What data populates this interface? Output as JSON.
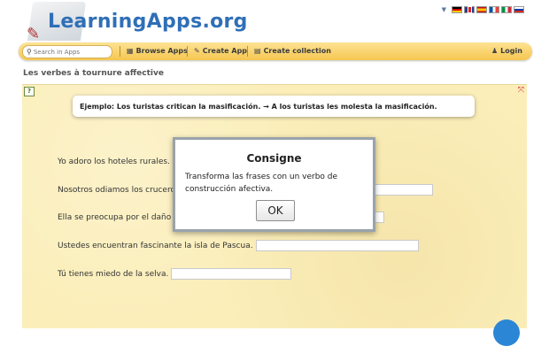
{
  "header": {
    "logo_text": "LearningApps.org",
    "flags": [
      "de",
      "gb",
      "es",
      "fr",
      "it",
      "ru"
    ]
  },
  "navbar": {
    "search_placeholder": "Search in Apps",
    "browse_label": "Browse Apps",
    "create_app_label": "Create App",
    "create_collection_label": "Create collection",
    "login_label": "Login"
  },
  "page": {
    "title": "Les verbes à tournure affective"
  },
  "app": {
    "example": "Ejemplo: Los turistas critican la masificación. → A los turistas les molesta la masificación.",
    "rows": [
      {
        "text": "Yo adoro los hoteles rurales."
      },
      {
        "text": "Nosotros odiamos los cruceros."
      },
      {
        "text": "Ella se preocupa por el daño"
      },
      {
        "text": "Ustedes encuentran fascinante la isla de Pascua."
      },
      {
        "text": "Tú tienes miedo de la selva."
      }
    ]
  },
  "dialog": {
    "title": "Consigne",
    "text": "Transforma las frases con un verbo de construcción afectiva.",
    "ok_label": "OK"
  },
  "colors": {
    "navbar": "#f6c650",
    "app_background": "#fbeeb9",
    "logo": "#2f6fb7",
    "round_button": "#2b86d6"
  }
}
